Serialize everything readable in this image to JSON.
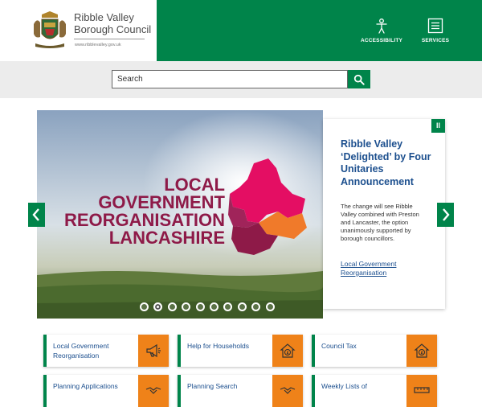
{
  "header": {
    "council_name_line1": "Ribble Valley",
    "council_name_line2": "Borough Council",
    "council_url": "www.ribblevalley.gov.uk",
    "buttons": [
      {
        "label": "ACCESSIBILITY",
        "icon": "accessibility-person-icon"
      },
      {
        "label": "SERVICES",
        "icon": "services-list-icon"
      }
    ]
  },
  "search": {
    "placeholder": "Search",
    "button_icon": "search-icon"
  },
  "carousel": {
    "image_text": [
      "LOCAL",
      "GOVERNMENT",
      "REORGANISATION",
      "LANCASHIRE"
    ],
    "story_title": "Ribble Valley ‘Delighted’ by Four Unitaries Announcement",
    "story_body": "The change will see Ribble Valley combined with Preston and Lancaster, the option unanimously supported by borough councillors.",
    "story_link": "Local Government Reorganisation",
    "pause_label": "II",
    "dot_count": 10,
    "active_dot": 2
  },
  "tiles": [
    {
      "label": "Local Government Reorganisation",
      "icon": "megaphone-icon"
    },
    {
      "label": "Help for Households",
      "icon": "house-pound-icon"
    },
    {
      "label": "Council Tax",
      "icon": "house-pound-icon"
    },
    {
      "label": "Planning Applications",
      "icon": "handshake-icon"
    },
    {
      "label": "Planning Search",
      "icon": "handshake-icon"
    },
    {
      "label": "Weekly Lists of",
      "icon": "ruler-icon"
    }
  ],
  "colors": {
    "brand_green": "#00844a",
    "accent_orange": "#ef8219",
    "link_blue": "#1c4f8e",
    "hero_text": "#8e1a48"
  }
}
